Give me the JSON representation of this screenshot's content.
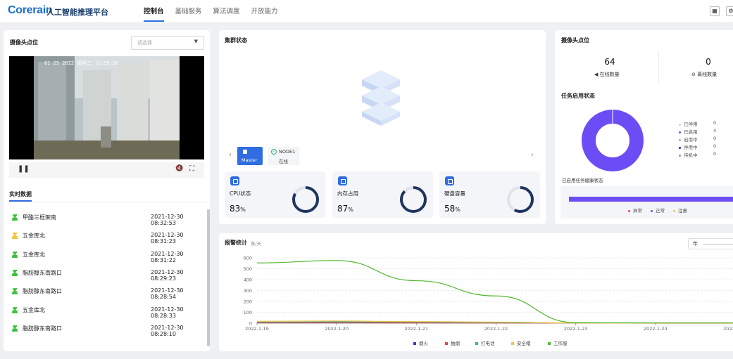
{
  "header": {
    "logo": "Corerain",
    "app_title": "人工智能推理平台",
    "nav": [
      "控制台",
      "基础服务",
      "算法调度",
      "开放能力"
    ],
    "active_nav": 0
  },
  "camera_panel": {
    "title": "摄像头点位",
    "select_placeholder": "请选择",
    "osd_text": "01 25 2022 星期二 11:55:26",
    "realtime_title": "实时数据",
    "rows": [
      {
        "name": "甲酯三框架南",
        "time": "2021-12-30 08:32:53",
        "color": "#3fbf3f"
      },
      {
        "name": "五金库北",
        "time": "2021-12-30 08:31:23",
        "color": "#f5c242"
      },
      {
        "name": "五金库北",
        "time": "2021-12-30 08:31:22",
        "color": "#3fbf3f"
      },
      {
        "name": "脂肪醇东南路口",
        "time": "2021-12-30 08:29:23",
        "color": "#3fbf3f"
      },
      {
        "name": "脂肪醇东南路口",
        "time": "2021-12-30 08:28:54",
        "color": "#3fbf3f"
      },
      {
        "name": "五金库北",
        "time": "2021-12-30 08:28:33",
        "color": "#3fbf3f"
      },
      {
        "name": "脂肪醇东南路口",
        "time": "2021-12-30 08:28:10",
        "color": "#3fbf3f"
      }
    ]
  },
  "cluster": {
    "title": "集群状态",
    "master_label": "Master",
    "node_label": "NODE1",
    "node_status": "在线",
    "metrics": [
      {
        "label": "CPU状态",
        "value": "83",
        "unit": "%",
        "pct": 83
      },
      {
        "label": "内存占用",
        "value": "87",
        "unit": "%",
        "pct": 87
      },
      {
        "label": "硬盘容量",
        "value": "58",
        "unit": "%",
        "pct": 58
      }
    ]
  },
  "camera_stats": {
    "title": "摄像头点位",
    "online_count": "64",
    "online_label": "在线数量",
    "offline_count": "0",
    "offline_label": "离线数量",
    "task_title": "任务启用状态",
    "legend": [
      {
        "label": "已停用",
        "count": "0",
        "color": "#cfcfcf"
      },
      {
        "label": "已启用",
        "count": "4",
        "color": "#6c4df5"
      },
      {
        "label": "启用中",
        "count": "0",
        "color": "#a99cf7"
      },
      {
        "label": "停用中",
        "count": "0",
        "color": "#1d2b8f"
      },
      {
        "label": "待机中",
        "count": "0",
        "color": "#8a8fa8"
      }
    ],
    "health_title": "已启用任务健康状态",
    "health_legend": [
      {
        "label": "异常",
        "color": "#e64545"
      },
      {
        "label": "正常",
        "color": "#6c4df5"
      },
      {
        "label": "注意",
        "color": "#f5c242"
      }
    ]
  },
  "alarm": {
    "title": "报警统计",
    "unit": "条/天",
    "range_label": "年"
  },
  "chart_data": {
    "type": "line",
    "title": "报警统计",
    "x": [
      "2022-1-19",
      "2022-1-20",
      "2022-1-21",
      "2022-1-22",
      "2022-1-23",
      "2022-1-24",
      "2022-1-25"
    ],
    "ylim": [
      0,
      600
    ],
    "yticks": [
      0,
      100,
      200,
      300,
      400,
      500,
      600
    ],
    "series": [
      {
        "name": "烟火",
        "color": "#2f3fc4",
        "values": [
          8,
          10,
          8,
          5,
          2,
          1,
          1
        ]
      },
      {
        "name": "抽烟",
        "color": "#e64545",
        "values": [
          3,
          3,
          2,
          2,
          1,
          0,
          0
        ]
      },
      {
        "name": "打电话",
        "color": "#2db3a0",
        "values": [
          10,
          12,
          10,
          6,
          2,
          1,
          1
        ]
      },
      {
        "name": "安全帽",
        "color": "#f5c242",
        "values": [
          18,
          20,
          15,
          10,
          2,
          1,
          1
        ]
      },
      {
        "name": "工作服",
        "color": "#52b82f",
        "values": [
          553,
          575,
          390,
          250,
          5,
          2,
          2
        ]
      }
    ],
    "legend_position": "bottom"
  }
}
